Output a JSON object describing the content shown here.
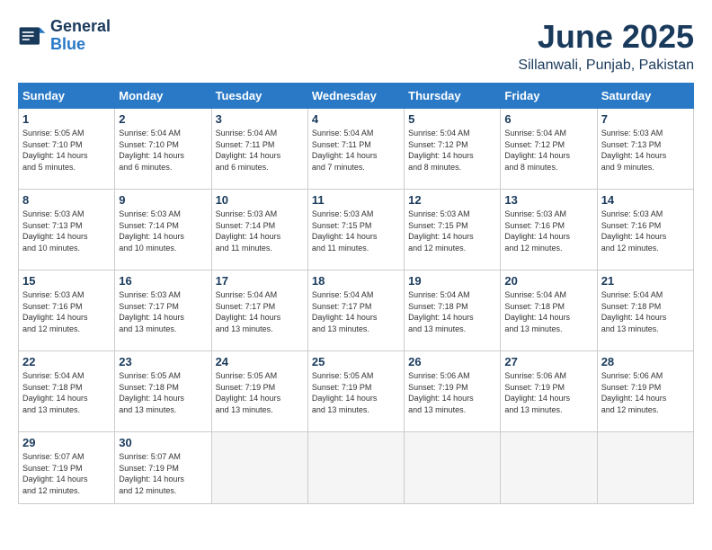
{
  "header": {
    "logo_line1": "General",
    "logo_line2": "Blue",
    "title": "June 2025",
    "subtitle": "Sillanwali, Punjab, Pakistan"
  },
  "calendar": {
    "days_of_week": [
      "Sunday",
      "Monday",
      "Tuesday",
      "Wednesday",
      "Thursday",
      "Friday",
      "Saturday"
    ],
    "weeks": [
      [
        {
          "day": "",
          "info": ""
        },
        {
          "day": "2",
          "info": "Sunrise: 5:04 AM\nSunset: 7:10 PM\nDaylight: 14 hours\nand 6 minutes."
        },
        {
          "day": "3",
          "info": "Sunrise: 5:04 AM\nSunset: 7:11 PM\nDaylight: 14 hours\nand 6 minutes."
        },
        {
          "day": "4",
          "info": "Sunrise: 5:04 AM\nSunset: 7:11 PM\nDaylight: 14 hours\nand 7 minutes."
        },
        {
          "day": "5",
          "info": "Sunrise: 5:04 AM\nSunset: 7:12 PM\nDaylight: 14 hours\nand 8 minutes."
        },
        {
          "day": "6",
          "info": "Sunrise: 5:04 AM\nSunset: 7:12 PM\nDaylight: 14 hours\nand 8 minutes."
        },
        {
          "day": "7",
          "info": "Sunrise: 5:03 AM\nSunset: 7:13 PM\nDaylight: 14 hours\nand 9 minutes."
        }
      ],
      [
        {
          "day": "8",
          "info": "Sunrise: 5:03 AM\nSunset: 7:13 PM\nDaylight: 14 hours\nand 10 minutes."
        },
        {
          "day": "9",
          "info": "Sunrise: 5:03 AM\nSunset: 7:14 PM\nDaylight: 14 hours\nand 10 minutes."
        },
        {
          "day": "10",
          "info": "Sunrise: 5:03 AM\nSunset: 7:14 PM\nDaylight: 14 hours\nand 11 minutes."
        },
        {
          "day": "11",
          "info": "Sunrise: 5:03 AM\nSunset: 7:15 PM\nDaylight: 14 hours\nand 11 minutes."
        },
        {
          "day": "12",
          "info": "Sunrise: 5:03 AM\nSunset: 7:15 PM\nDaylight: 14 hours\nand 12 minutes."
        },
        {
          "day": "13",
          "info": "Sunrise: 5:03 AM\nSunset: 7:16 PM\nDaylight: 14 hours\nand 12 minutes."
        },
        {
          "day": "14",
          "info": "Sunrise: 5:03 AM\nSunset: 7:16 PM\nDaylight: 14 hours\nand 12 minutes."
        }
      ],
      [
        {
          "day": "15",
          "info": "Sunrise: 5:03 AM\nSunset: 7:16 PM\nDaylight: 14 hours\nand 12 minutes."
        },
        {
          "day": "16",
          "info": "Sunrise: 5:03 AM\nSunset: 7:17 PM\nDaylight: 14 hours\nand 13 minutes."
        },
        {
          "day": "17",
          "info": "Sunrise: 5:04 AM\nSunset: 7:17 PM\nDaylight: 14 hours\nand 13 minutes."
        },
        {
          "day": "18",
          "info": "Sunrise: 5:04 AM\nSunset: 7:17 PM\nDaylight: 14 hours\nand 13 minutes."
        },
        {
          "day": "19",
          "info": "Sunrise: 5:04 AM\nSunset: 7:18 PM\nDaylight: 14 hours\nand 13 minutes."
        },
        {
          "day": "20",
          "info": "Sunrise: 5:04 AM\nSunset: 7:18 PM\nDaylight: 14 hours\nand 13 minutes."
        },
        {
          "day": "21",
          "info": "Sunrise: 5:04 AM\nSunset: 7:18 PM\nDaylight: 14 hours\nand 13 minutes."
        }
      ],
      [
        {
          "day": "22",
          "info": "Sunrise: 5:04 AM\nSunset: 7:18 PM\nDaylight: 14 hours\nand 13 minutes."
        },
        {
          "day": "23",
          "info": "Sunrise: 5:05 AM\nSunset: 7:18 PM\nDaylight: 14 hours\nand 13 minutes."
        },
        {
          "day": "24",
          "info": "Sunrise: 5:05 AM\nSunset: 7:19 PM\nDaylight: 14 hours\nand 13 minutes."
        },
        {
          "day": "25",
          "info": "Sunrise: 5:05 AM\nSunset: 7:19 PM\nDaylight: 14 hours\nand 13 minutes."
        },
        {
          "day": "26",
          "info": "Sunrise: 5:06 AM\nSunset: 7:19 PM\nDaylight: 14 hours\nand 13 minutes."
        },
        {
          "day": "27",
          "info": "Sunrise: 5:06 AM\nSunset: 7:19 PM\nDaylight: 14 hours\nand 13 minutes."
        },
        {
          "day": "28",
          "info": "Sunrise: 5:06 AM\nSunset: 7:19 PM\nDaylight: 14 hours\nand 12 minutes."
        }
      ],
      [
        {
          "day": "29",
          "info": "Sunrise: 5:07 AM\nSunset: 7:19 PM\nDaylight: 14 hours\nand 12 minutes."
        },
        {
          "day": "30",
          "info": "Sunrise: 5:07 AM\nSunset: 7:19 PM\nDaylight: 14 hours\nand 12 minutes."
        },
        {
          "day": "",
          "info": ""
        },
        {
          "day": "",
          "info": ""
        },
        {
          "day": "",
          "info": ""
        },
        {
          "day": "",
          "info": ""
        },
        {
          "day": "",
          "info": ""
        }
      ]
    ],
    "week1_sunday": {
      "day": "1",
      "info": "Sunrise: 5:05 AM\nSunset: 7:10 PM\nDaylight: 14 hours\nand 5 minutes."
    }
  }
}
